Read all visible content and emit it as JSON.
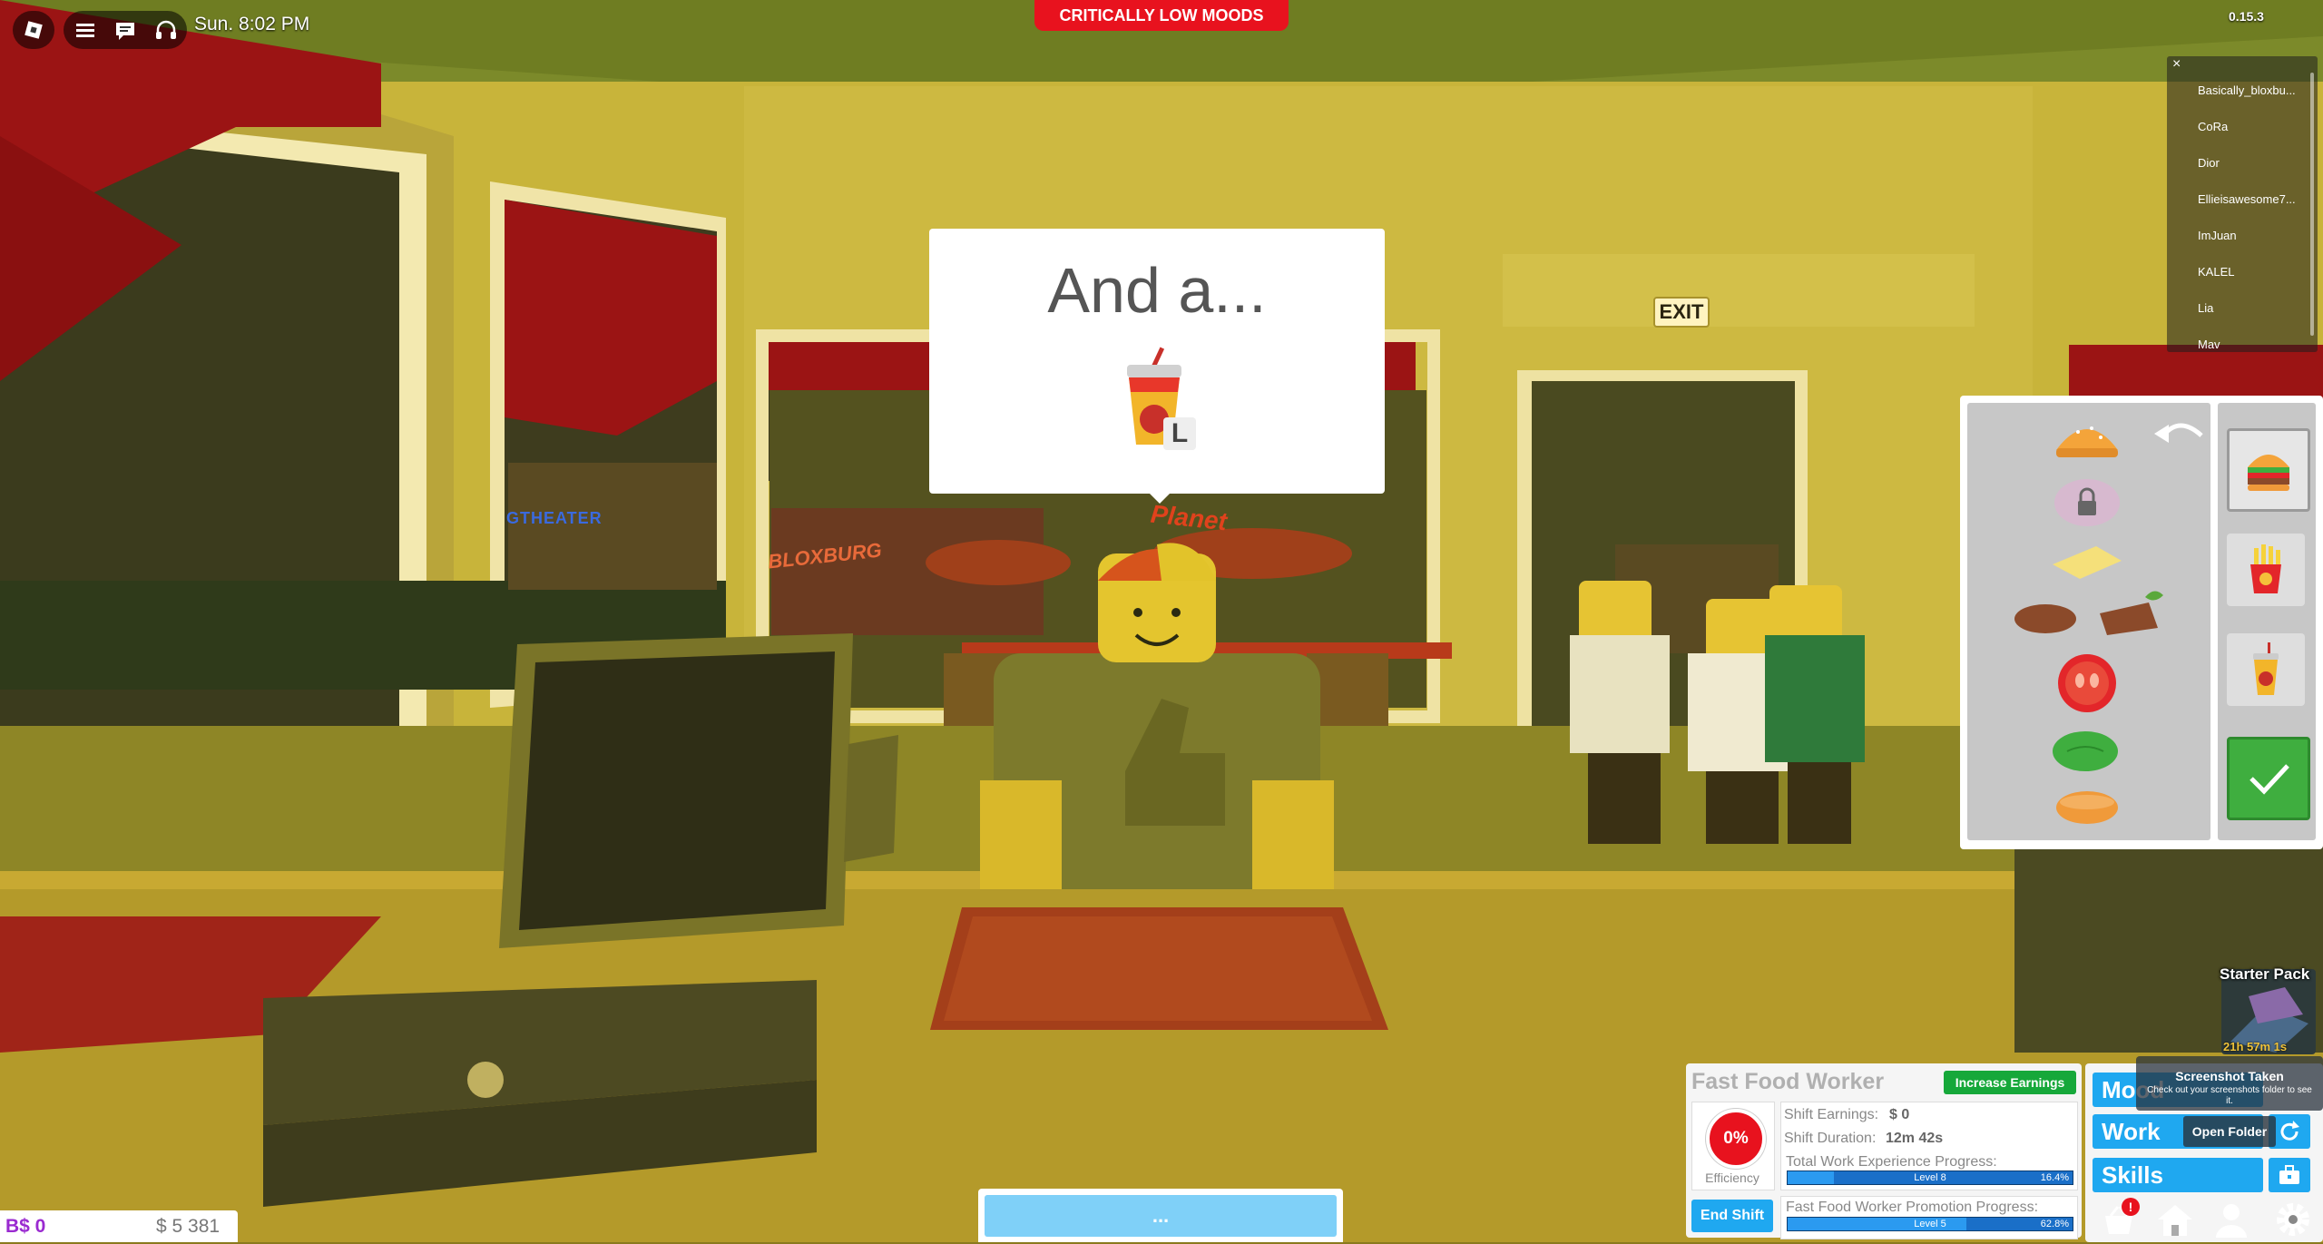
{
  "topbar": {
    "clock": "Sun. 8:02 PM",
    "version": "0.15.3",
    "alert": "CRITICALLY LOW MOODS"
  },
  "scene": {
    "exit_sign": "EXIT",
    "theater_sign": "GTHEATER",
    "bloxburg_sign": "BLOXBURG",
    "planet_sign": "Planet"
  },
  "player_list": {
    "close": "×",
    "players": [
      "Basically_bloxbu...",
      "CoRa",
      "Dior",
      "Ellieisawesome7...",
      "ImJuan",
      "KALEL",
      "Lia",
      "Mav"
    ]
  },
  "order_bubble": {
    "text": "And a...",
    "size_label": "L"
  },
  "order_panel": {
    "undo_icon": "undo-arrow-icon",
    "categories": [
      "burger",
      "fries",
      "drink"
    ],
    "confirm_icon": "checkmark-icon"
  },
  "starter_pack": {
    "title": "Starter Pack",
    "timer": "21h 57m 1s"
  },
  "job": {
    "title": "Fast Food Worker",
    "increase_earnings": "Increase Earnings",
    "efficiency_value": "0%",
    "efficiency_label": "Efficiency",
    "shift_earnings_label": "Shift Earnings:",
    "shift_earnings_value": "$ 0",
    "shift_duration_label": "Shift Duration:",
    "shift_duration_value": "12m 42s",
    "total_xp_label": "Total Work Experience Progress:",
    "total_xp_level": "Level 8",
    "total_xp_pct": "16.4%",
    "total_xp_fraction": 0.164,
    "promotion_label": "Fast Food Worker Promotion Progress:",
    "promotion_level": "Level 5",
    "promotion_pct": "62.8%",
    "promotion_fraction": 0.628,
    "end_shift": "End Shift"
  },
  "side_menu": {
    "mood": "Mood",
    "work": "Work",
    "skills": "Skills",
    "notification_badge": "!"
  },
  "screenshot_toast": {
    "title": "Screenshot Taken",
    "message": "Check out your screenshots folder to see it.",
    "open_folder": "Open Folder"
  },
  "currency": {
    "bux": "B$ 0",
    "money": "$ 5 381"
  },
  "chat_bar": {
    "placeholder": "..."
  },
  "colors": {
    "alert_red": "#e8121e",
    "accent_blue": "#1fa8f0",
    "confirm_green": "#3fae3f",
    "earnings_green": "#16a83a"
  }
}
